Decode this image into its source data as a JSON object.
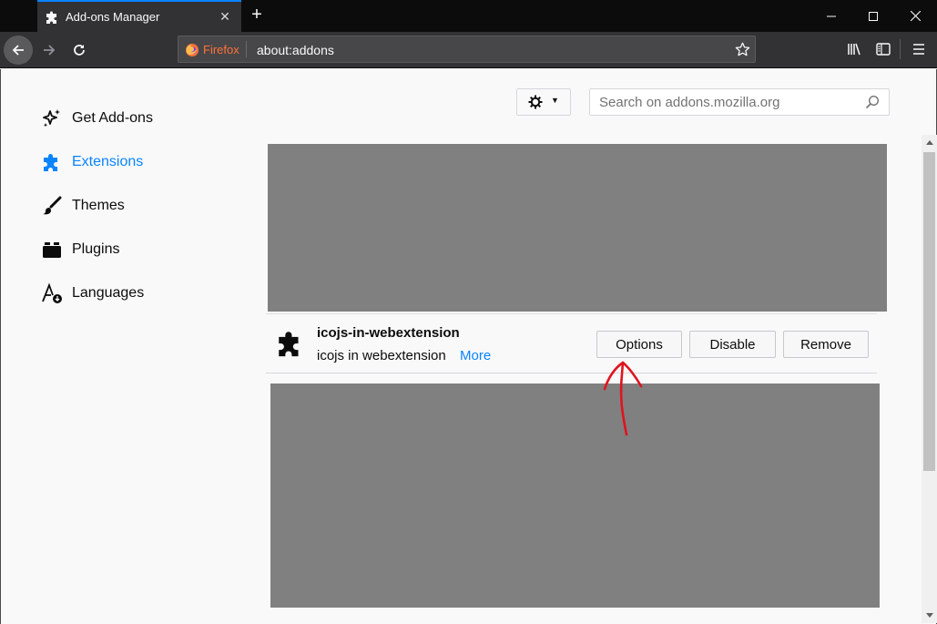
{
  "tab": {
    "title": "Add-ons Manager"
  },
  "urlbar": {
    "identity": "Firefox",
    "url": "about:addons"
  },
  "sidebar": {
    "items": [
      {
        "label": "Get Add-ons",
        "icon": "get-addons-icon"
      },
      {
        "label": "Extensions",
        "icon": "extensions-icon",
        "selected": true
      },
      {
        "label": "Themes",
        "icon": "themes-icon"
      },
      {
        "label": "Plugins",
        "icon": "plugins-icon"
      },
      {
        "label": "Languages",
        "icon": "languages-icon"
      }
    ]
  },
  "search": {
    "placeholder": "Search on addons.mozilla.org"
  },
  "addon": {
    "name": "icojs-in-webextension",
    "description": "icojs in webextension",
    "more_label": "More",
    "options_label": "Options",
    "disable_label": "Disable",
    "remove_label": "Remove"
  },
  "colors": {
    "accent": "#0a84ff",
    "tabstrip": "#0c0c0d",
    "toolbar": "#323234",
    "annotation": "#e0141e",
    "redacted": "#808080"
  }
}
